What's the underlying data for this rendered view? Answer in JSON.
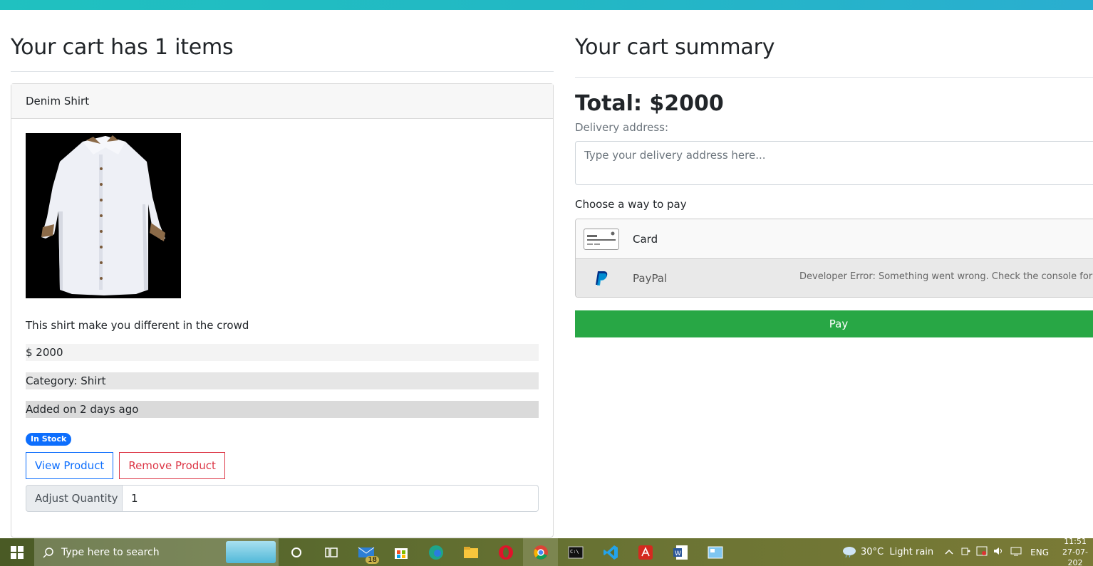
{
  "cart": {
    "heading": "Your cart has 1 items",
    "item": {
      "name": "Denim Shirt",
      "description": "This shirt make you different in the crowd",
      "price": "$ 2000",
      "category": "Category: Shirt",
      "added": "Added on 2 days ago",
      "stock_badge": "In Stock",
      "view_button": "View Product",
      "remove_button": "Remove Product",
      "quantity_label": "Adjust Quantity",
      "quantity_value": "1"
    }
  },
  "summary": {
    "heading": "Your cart summary",
    "total": "Total: $2000",
    "address_label": "Delivery address:",
    "address_placeholder": "Type your delivery address here...",
    "pay_label": "Choose a way to pay",
    "methods": {
      "card": "Card",
      "paypal": "PayPal",
      "paypal_error": "Developer Error: Something went wrong. Check the console for det"
    },
    "pay_button": "Pay"
  },
  "taskbar": {
    "search_placeholder": "Type here to search",
    "mail_badge": "18",
    "weather": "30°C  Light rain",
    "language": "ENG",
    "time": "11:51",
    "date": "27-07-202"
  },
  "colors": {
    "accent": "#0d6efd",
    "danger": "#dc3545",
    "success": "#28a745",
    "topbar": "#22b8c4"
  }
}
